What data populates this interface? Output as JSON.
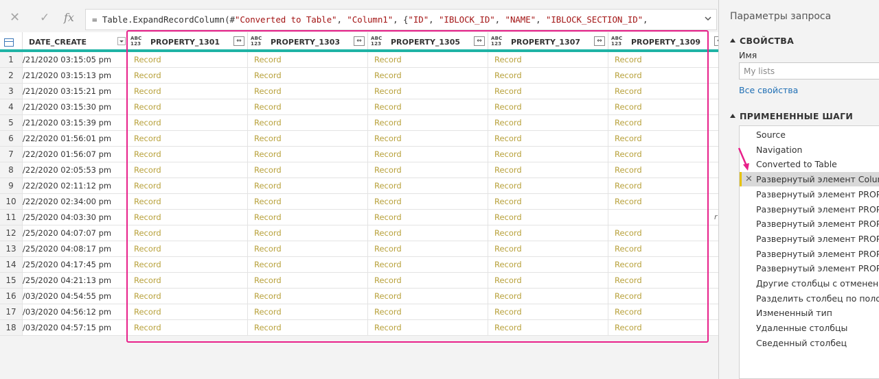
{
  "formula": {
    "cancel_icon": "✕",
    "confirm_icon": "✓",
    "fx_label": "fx",
    "eq": "= Table.ExpandRecordColumn(#",
    "s1": "\"Converted to Table\"",
    "c1": ", ",
    "s2": "\"Column1\"",
    "c2": ", {",
    "s3": "\"ID\"",
    "c3": ", ",
    "s4": "\"IBLOCK_ID\"",
    "c4": ", ",
    "s5": "\"NAME\"",
    "c5": ", ",
    "s6": "\"IBLOCK_SECTION_ID\"",
    "c6": ","
  },
  "grid": {
    "date_header": "DATE_CREATE",
    "type_label_top": "ABC",
    "type_label_bottom": "123",
    "expand_glyph": "⇔",
    "edge_char": "r",
    "prop_headers": [
      "PROPERTY_1301",
      "PROPERTY_1303",
      "PROPERTY_1305",
      "PROPERTY_1307",
      "PROPERTY_1309"
    ],
    "rows": [
      {
        "n": "1",
        "date": "/21/2020 03:15:05 pm",
        "vals": [
          "Record",
          "Record",
          "Record",
          "Record",
          "Record"
        ]
      },
      {
        "n": "2",
        "date": "/21/2020 03:15:13 pm",
        "vals": [
          "Record",
          "Record",
          "Record",
          "Record",
          "Record"
        ]
      },
      {
        "n": "3",
        "date": "/21/2020 03:15:21 pm",
        "vals": [
          "Record",
          "Record",
          "Record",
          "Record",
          "Record"
        ]
      },
      {
        "n": "4",
        "date": "/21/2020 03:15:30 pm",
        "vals": [
          "Record",
          "Record",
          "Record",
          "Record",
          "Record"
        ]
      },
      {
        "n": "5",
        "date": "/21/2020 03:15:39 pm",
        "vals": [
          "Record",
          "Record",
          "Record",
          "Record",
          "Record"
        ]
      },
      {
        "n": "6",
        "date": "/22/2020 01:56:01 pm",
        "vals": [
          "Record",
          "Record",
          "Record",
          "Record",
          "Record"
        ]
      },
      {
        "n": "7",
        "date": "/22/2020 01:56:07 pm",
        "vals": [
          "Record",
          "Record",
          "Record",
          "Record",
          "Record"
        ]
      },
      {
        "n": "8",
        "date": "/22/2020 02:05:53 pm",
        "vals": [
          "Record",
          "Record",
          "Record",
          "Record",
          "Record"
        ]
      },
      {
        "n": "9",
        "date": "/22/2020 02:11:12 pm",
        "vals": [
          "Record",
          "Record",
          "Record",
          "Record",
          "Record"
        ]
      },
      {
        "n": "10",
        "date": "/22/2020 02:34:00 pm",
        "vals": [
          "Record",
          "Record",
          "Record",
          "Record",
          "Record"
        ]
      },
      {
        "n": "11",
        "date": "/25/2020 04:03:30 pm",
        "vals": [
          "Record",
          "Record",
          "Record",
          "Record",
          ""
        ]
      },
      {
        "n": "12",
        "date": "/25/2020 04:07:07 pm",
        "vals": [
          "Record",
          "Record",
          "Record",
          "Record",
          "Record"
        ]
      },
      {
        "n": "13",
        "date": "/25/2020 04:08:17 pm",
        "vals": [
          "Record",
          "Record",
          "Record",
          "Record",
          "Record"
        ]
      },
      {
        "n": "14",
        "date": "/25/2020 04:17:45 pm",
        "vals": [
          "Record",
          "Record",
          "Record",
          "Record",
          "Record"
        ]
      },
      {
        "n": "15",
        "date": "/25/2020 04:21:13 pm",
        "vals": [
          "Record",
          "Record",
          "Record",
          "Record",
          "Record"
        ]
      },
      {
        "n": "16",
        "date": "/03/2020 04:54:55 pm",
        "vals": [
          "Record",
          "Record",
          "Record",
          "Record",
          "Record"
        ]
      },
      {
        "n": "17",
        "date": "/03/2020 04:56:12 pm",
        "vals": [
          "Record",
          "Record",
          "Record",
          "Record",
          "Record"
        ]
      },
      {
        "n": "18",
        "date": "/03/2020 04:57:15 pm",
        "vals": [
          "Record",
          "Record",
          "Record",
          "Record",
          "Record"
        ]
      }
    ]
  },
  "panel": {
    "title": "Параметры запроса",
    "properties_header": "СВОЙСТВА",
    "name_label": "Имя",
    "name_value": "My lists",
    "all_properties_link": "Все свойства",
    "steps_header": "ПРИМЕНЕННЫЕ ШАГИ",
    "step_delete_icon": "✕",
    "steps": [
      "Source",
      "Navigation",
      "Converted to Table",
      "Развернутый элемент Colum...",
      "Развернутый элемент PROPE...",
      "Развернутый элемент PROPE...",
      "Развернутый элемент PROPE...",
      "Развернутый элемент PROPE...",
      "Развернутый элемент PROPE...",
      "Развернутый элемент PROPE...",
      "Другие столбцы с отменен...",
      "Разделить столбец по поло...",
      "Измененный тип",
      "Удаленные столбцы",
      "Сведенный столбец"
    ],
    "selected_step_index": 3
  },
  "colors": {
    "record_text": "#b8a13b",
    "highlight_border": "#e8208a",
    "header_underline": "#1fb3a5",
    "link": "#1f6fb5",
    "selected_step_marker": "#e6c200"
  }
}
